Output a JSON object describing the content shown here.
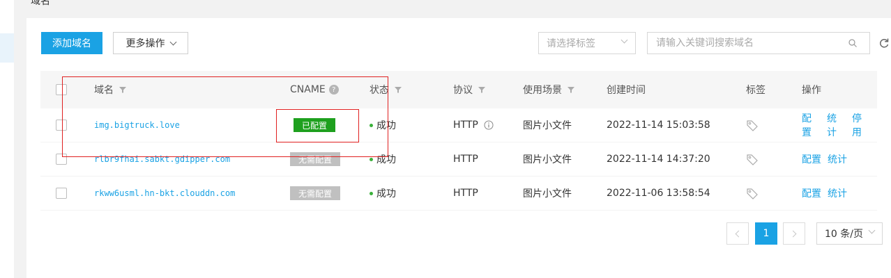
{
  "header": {
    "title": "域名"
  },
  "toolbar": {
    "add_domain": "添加域名",
    "more_actions": "更多操作",
    "tag_select_placeholder": "请选择标签",
    "search_placeholder": "请输入关键词搜索域名"
  },
  "table": {
    "columns": {
      "domain": "域名",
      "cname": "CNAME",
      "status": "状态",
      "protocol": "协议",
      "scenario": "使用场景",
      "created": "创建时间",
      "tags": "标签",
      "actions": "操作"
    },
    "rows": [
      {
        "domain": "img.bigtruck.love",
        "cname": "已配置",
        "status": "成功",
        "protocol": "HTTP",
        "scenario": "图片小文件",
        "created": "2022-11-14 15:03:58",
        "actions": [
          "配置",
          "统计",
          "停用"
        ]
      },
      {
        "domain": "rlbr9fhai.sabkt.gdipper.com",
        "cname": "无需配置",
        "status": "成功",
        "protocol": "HTTP",
        "scenario": "图片小文件",
        "created": "2022-11-14 14:37:20",
        "actions": [
          "配置",
          "统计"
        ]
      },
      {
        "domain": "rkww6usml.hn-bkt.clouddn.com",
        "cname": "无需配置",
        "status": "成功",
        "protocol": "HTTP",
        "scenario": "图片小文件",
        "created": "2022-11-06 13:58:54",
        "actions": [
          "配置",
          "统计"
        ]
      }
    ]
  },
  "pagination": {
    "current_page": "1",
    "page_size": "10 条/页"
  },
  "colors": {
    "accent": "#1aa2e4",
    "configured": "#1ea01e",
    "not_required": "#c0c0c0",
    "annotation": "#e02020"
  }
}
